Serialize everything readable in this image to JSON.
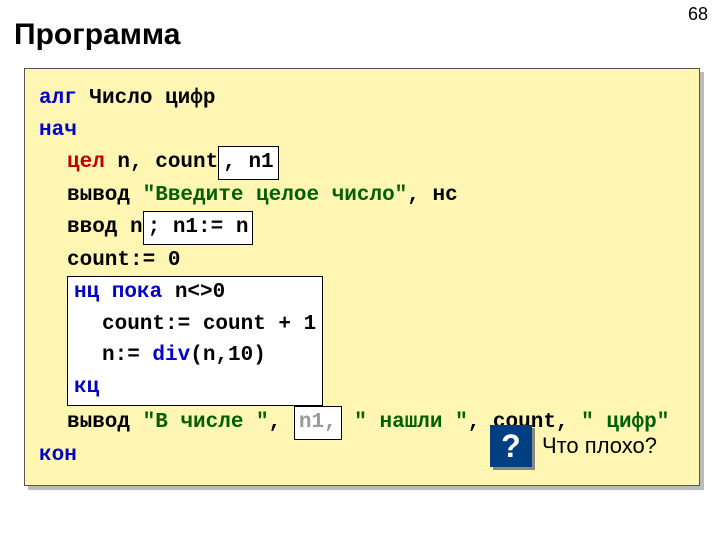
{
  "page_number": "68",
  "title": "Программа",
  "code": {
    "l1_kw": "алг",
    "l1_rest": " Число цифр",
    "l2": "нач",
    "l3_kw": "цел",
    "l3_rest": " n, count",
    "l3_box": ", n1",
    "l4_a": "вывод ",
    "l4_str": "\"Введите целое число\"",
    "l4_b": ", нс",
    "l5_a": "ввод n",
    "l5_box": "; n1:= n",
    "l6": "count:= 0",
    "loop_l1_a": "нц пока",
    "loop_l1_b": " n<>0",
    "loop_l2": "count:= count + 1",
    "loop_l3_a": "n:= ",
    "loop_l3_fn": "div",
    "loop_l3_b": "(n,10)",
    "loop_l4": "кц",
    "l8_a": "вывод ",
    "l8_s1": "\"В числе \"",
    "l8_b": ", ",
    "l8_box": "n1,",
    "l8_s2": " \" нашли \"",
    "l8_c": ", count, ",
    "l8_s3": "\" цифр\"",
    "l9": "кон"
  },
  "question": {
    "mark": "?",
    "text": "Что плохо?"
  }
}
